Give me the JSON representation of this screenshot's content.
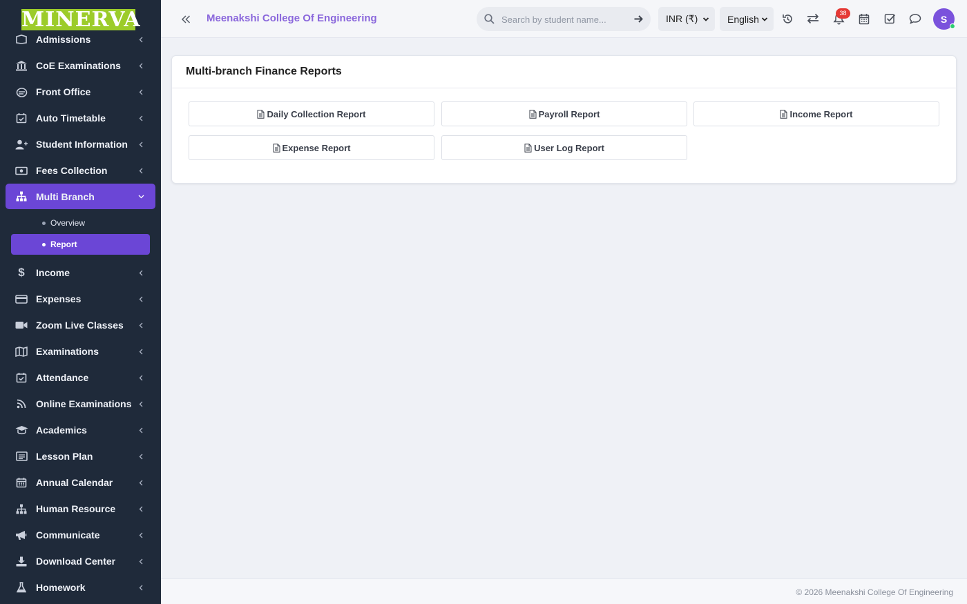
{
  "brand": {
    "logo_text": "MINERVA",
    "logo_color": "#9ccc2a"
  },
  "header": {
    "college_name": "Meenakshi College Of Engineering",
    "search_placeholder": "Search by student name...",
    "currency": "INR (₹)",
    "language": "English",
    "notification_count": "38",
    "avatar_initial": "S"
  },
  "sidebar": {
    "items": [
      {
        "label": "Admissions",
        "icon": "admissions-icon"
      },
      {
        "label": "CoE Examinations",
        "icon": "bank-icon"
      },
      {
        "label": "Front Office",
        "icon": "front-office-icon"
      },
      {
        "label": "Auto Timetable",
        "icon": "calendar-check-icon"
      },
      {
        "label": "Student Information",
        "icon": "user-plus-icon"
      },
      {
        "label": "Fees Collection",
        "icon": "money-icon"
      },
      {
        "label": "Multi Branch",
        "icon": "sitemap-icon",
        "active": true
      },
      {
        "label": "Income",
        "icon": "dollar-icon"
      },
      {
        "label": "Expenses",
        "icon": "credit-card-icon"
      },
      {
        "label": "Zoom Live Classes",
        "icon": "video-icon"
      },
      {
        "label": "Examinations",
        "icon": "map-icon"
      },
      {
        "label": "Attendance",
        "icon": "calendar-check-icon"
      },
      {
        "label": "Online Examinations",
        "icon": "rss-icon"
      },
      {
        "label": "Academics",
        "icon": "graduation-cap-icon"
      },
      {
        "label": "Lesson Plan",
        "icon": "list-alt-icon"
      },
      {
        "label": "Annual Calendar",
        "icon": "calendar-icon"
      },
      {
        "label": "Human Resource",
        "icon": "sitemap-icon"
      },
      {
        "label": "Communicate",
        "icon": "bullhorn-icon"
      },
      {
        "label": "Download Center",
        "icon": "download-icon"
      },
      {
        "label": "Homework",
        "icon": "flask-icon"
      }
    ],
    "submenu": [
      {
        "label": "Overview"
      },
      {
        "label": "Report",
        "active": true
      }
    ]
  },
  "main": {
    "card_title": "Multi-branch Finance Reports",
    "reports": [
      {
        "label": "Daily Collection Report"
      },
      {
        "label": "Payroll Report"
      },
      {
        "label": "Income Report"
      },
      {
        "label": "Expense Report"
      },
      {
        "label": "User Log Report"
      }
    ]
  },
  "footer": {
    "text": "© 2026 Meenakshi College Of Engineering"
  },
  "colors": {
    "accent": "#6b46d6",
    "sidebar_bg": "#1f2a3a",
    "title": "#8b68dc",
    "badge": "#e53935"
  }
}
